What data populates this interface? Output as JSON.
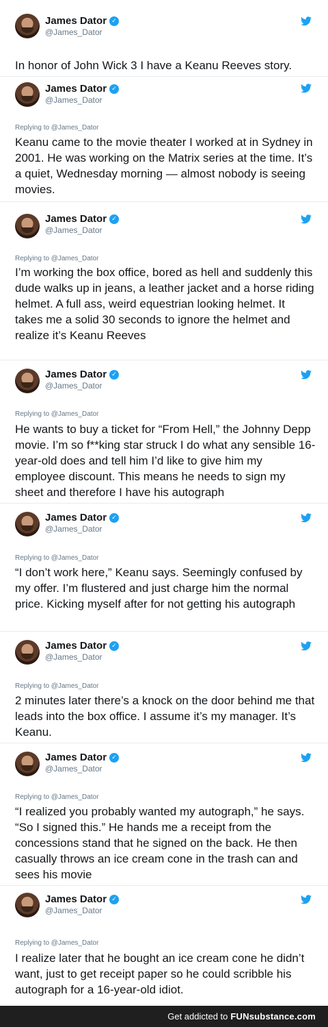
{
  "author": {
    "name": "James Dator",
    "handle": "@James_Dator"
  },
  "tweets": [
    {
      "reply": "",
      "text": "In honor of John Wick 3 I have a Keanu Reeves story."
    },
    {
      "reply": "Replying to @James_Dator",
      "text": "Keanu came to the movie theater I worked at in Sydney in 2001. He was working on the Matrix series at the time. It’s a quiet, Wednesday morning — almost nobody is seeing movies."
    },
    {
      "reply": "Replying to @James_Dator",
      "text": "I’m working the box office, bored as hell and suddenly this dude walks up in jeans, a leather jacket and a horse riding helmet. A full ass, weird equestrian looking helmet. It takes me a solid 30 seconds to ignore the helmet and realize it’s Keanu Reeves"
    },
    {
      "reply": "Replying to @James_Dator",
      "text": "He wants to buy a ticket for “From Hell,” the Johnny Depp movie. I’m so f**king star struck I do what any sensible 16-year-old does and tell him I’d like to give him my employee discount. This means he needs to sign my sheet and therefore I have his autograph"
    },
    {
      "reply": "Replying to @James_Dator",
      "text": "“I don’t work here,” Keanu says. Seemingly confused by my offer. I’m flustered and just charge him the normal price. Kicking myself after for not getting his autograph"
    },
    {
      "reply": "Replying to @James_Dator",
      "text": "2 minutes later there’s a knock on the door behind me that leads into the box office. I assume it’s my manager. It’s Keanu."
    },
    {
      "reply": "Replying to @James_Dator",
      "text": "“I realized you probably wanted my autograph,” he says. “So I signed this.” He hands me a receipt from the concessions stand that he signed on the back. He then casually throws an ice cream cone in the trash can and sees his movie"
    },
    {
      "reply": "Replying to @James_Dator",
      "text": "I realize later that he bought an ice cream cone he didn’t want, just to get receipt paper so he could scribble his autograph for a 16-year-old idiot."
    }
  ],
  "footer": {
    "tagline": "Get addicted to",
    "brand_fun": "FUN",
    "brand_substance": "substance",
    "brand_domain": ".com"
  }
}
